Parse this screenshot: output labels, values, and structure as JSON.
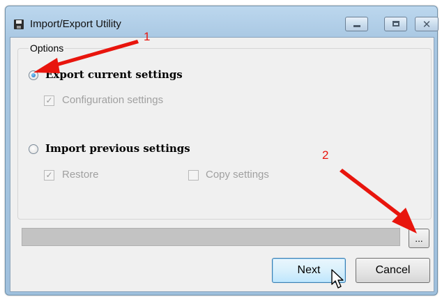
{
  "window": {
    "title": "Import/Export Utility",
    "controls": {
      "minimize": "minimize",
      "maximize": "maximize",
      "close": "✕"
    }
  },
  "options": {
    "group_label": "Options",
    "export": {
      "label": "Export current settings",
      "selected": true,
      "sub": {
        "label": "Configuration settings",
        "checked": true,
        "enabled": false
      }
    },
    "import": {
      "label": "Import previous settings",
      "selected": false,
      "sub": [
        {
          "label": "Restore",
          "checked": true,
          "enabled": false
        },
        {
          "label": "Copy settings",
          "checked": false,
          "enabled": false
        }
      ]
    }
  },
  "path": {
    "value": ""
  },
  "browse": {
    "label": "..."
  },
  "buttons": {
    "next": "Next",
    "cancel": "Cancel"
  },
  "annotations": {
    "one": "1",
    "two": "2"
  },
  "colors": {
    "annotation": "#e8150d",
    "next_border": "#3c7fb1"
  },
  "icons": [
    "save-disk-icon",
    "minimize-icon",
    "maximize-icon",
    "close-icon",
    "mouse-pointer-icon",
    "red-arrow-icon"
  ]
}
